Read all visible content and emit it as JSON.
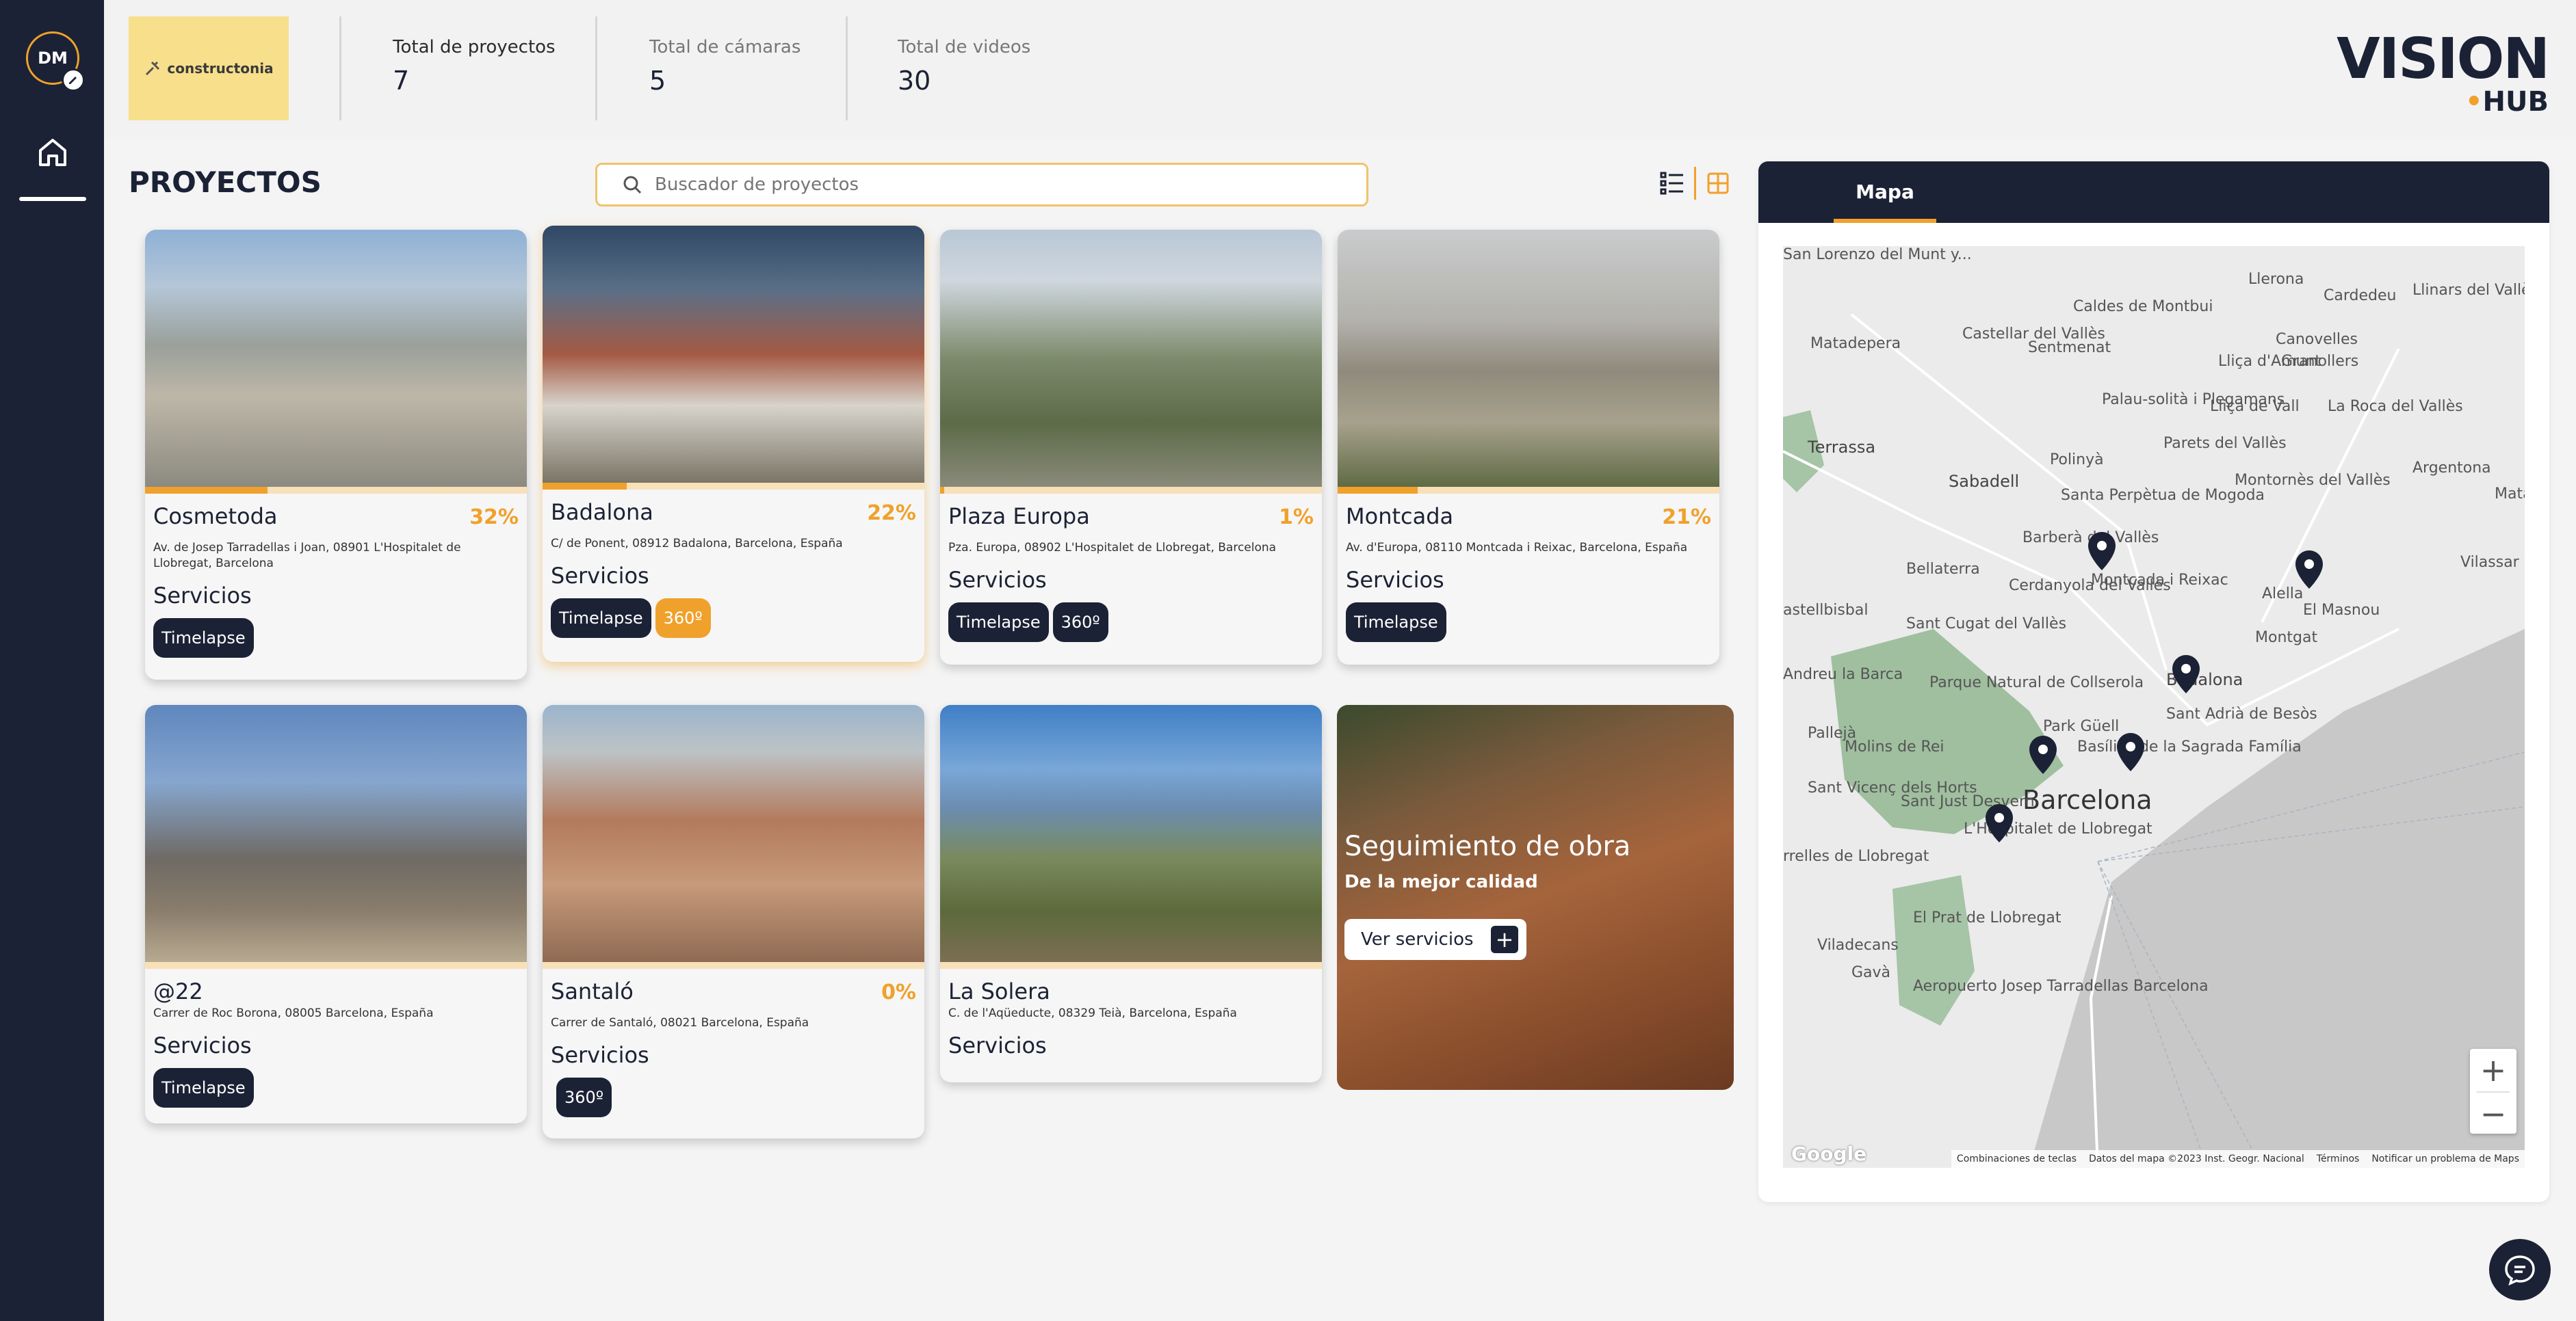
{
  "user": {
    "initials": "DM"
  },
  "header": {
    "company_logo_text": "constructonia",
    "stats": [
      {
        "label": "Total de proyectos",
        "value": "7"
      },
      {
        "label": "Total de cámaras",
        "value": "5"
      },
      {
        "label": "Total de videos",
        "value": "30"
      }
    ],
    "brand": {
      "main": "VISION",
      "sub": "HUB"
    }
  },
  "main": {
    "title": "PROYECTOS",
    "search_placeholder": "Buscador de proyectos",
    "projects": [
      {
        "name": "Cosmetoda",
        "percent": "32%",
        "progress": 0.32,
        "address": "Av. de Josep Tarradellas i Joan, 08901 L'Hospitalet de Llobregat, Barcelona",
        "services_label": "Servicios",
        "tags": [
          "Timelapse"
        ]
      },
      {
        "name": "Badalona",
        "percent": "22%",
        "progress": 0.22,
        "address": "C/ de Ponent, 08912 Badalona, Barcelona, España",
        "services_label": "Servicios",
        "tags": [
          "Timelapse",
          "360º"
        ]
      },
      {
        "name": "Plaza Europa",
        "percent": "1%",
        "progress": 0.01,
        "address": "Pza. Europa, 08902 L'Hospitalet de Llobregat, Barcelona",
        "services_label": "Servicios",
        "tags": [
          "Timelapse",
          "360º"
        ]
      },
      {
        "name": "Montcada",
        "percent": "21%",
        "progress": 0.21,
        "address": "Av. d'Europa, 08110 Montcada i Reixac, Barcelona, España",
        "services_label": "Servicios",
        "tags": [
          "Timelapse"
        ]
      },
      {
        "name": "@22",
        "percent": "",
        "progress": 0,
        "address": "Carrer de Roc Borona, 08005 Barcelona, España",
        "services_label": "Servicios",
        "tags": [
          "Timelapse"
        ]
      },
      {
        "name": "Santaló",
        "percent": "0%",
        "progress": 0,
        "address": "Carrer de Santaló, 08021 Barcelona, España",
        "services_label": "Servicios",
        "tags": [
          "360º"
        ]
      },
      {
        "name": "La Solera",
        "percent": "",
        "progress": 0,
        "address": "C. de l'Aqüeducte, 08329 Teià, Barcelona, España",
        "services_label": "Servicios",
        "tags": []
      }
    ],
    "promo": {
      "title": "Seguimiento de obra",
      "subtitle": "De la mejor calidad",
      "button": "Ver servicios",
      "button_icon": "+"
    }
  },
  "map_panel": {
    "tab": "Mapa",
    "labels": {
      "barcelona": "Barcelona",
      "badalona": "Badalona",
      "terrassa": "Terrassa",
      "sabadell": "Sabadell",
      "hospitalet": "L'Hospitalet de Llobregat",
      "montcada": "Montcada i Reixac",
      "el_masnou": "El Masnou",
      "granollers": "Granollers",
      "matadepera": "Matadepera",
      "sentmenat": "Sentmenat",
      "caldes": "Caldes de Montbui",
      "llerona": "Llerona",
      "cardedeu": "Cardedeu",
      "argentona": "Argentona",
      "polinya": "Polinyà",
      "barbera": "Barberà del Vallès",
      "cerdanyola": "Cerdanyola del Vallès",
      "bellaterra": "Bellaterra",
      "parque_natural": "Parque Natural de Collserola",
      "park_guell": "Park Güell",
      "molins": "Molins de Rei",
      "sant_cugat": "Sant Cugat del Vallès",
      "el_prat": "El Prat de Llobregat",
      "viladecans": "Viladecans",
      "gava": "Gavà",
      "aeropuerto": "Aeropuerto Josep Tarradellas Barcelona",
      "sant_lorenzo": "San Lorenzo del Munt y...",
      "castellar": "Castellar del Vallès",
      "montornes": "Montornès del Vallès",
      "la_roca": "La Roca del Vallès",
      "alella": "Alella",
      "montgat": "Montgat",
      "sant_adria": "Sant Adrià de Besòs",
      "sagrada_familia": "Basílica de la Sagrada Família",
      "sant_just": "Sant Just Desvern",
      "sant_vicenc": "Sant Vicenç dels Horts",
      "palleja": "Pallejà",
      "andreu": "Andreu la Barca",
      "castellbisbal": "astellbisbal",
      "corrales": "rrelles de Llobregat",
      "vilassar": "Vilassar de Dalt",
      "mataro": "Mataró",
      "santa_perpetua": "Santa Perpètua de Mogoda",
      "palau": "Palau-solità i Plegamans",
      "llica_vall": "Lliça de Vall",
      "llica_amunt": "Lliça d'Amunt",
      "canovelles": "Canovelles",
      "llinars": "Llinars del Vallès",
      "parets": "Parets del Vallès"
    },
    "zoom_in": "+",
    "zoom_out": "−",
    "google": "Google",
    "attribution": [
      "Combinaciones de teclas",
      "Datos del mapa ©2023 Inst. Geogr. Nacional",
      "Términos",
      "Notificar un problema de Maps"
    ]
  }
}
